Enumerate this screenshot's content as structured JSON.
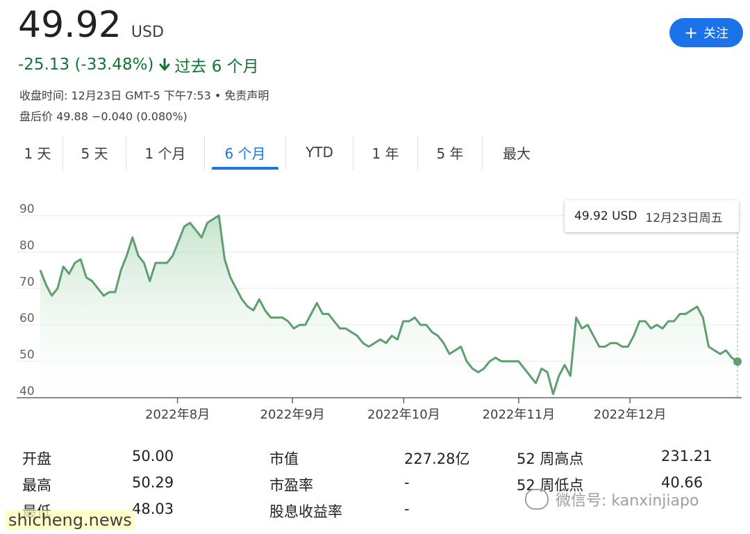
{
  "quote": {
    "price": "49.92",
    "currency": "USD",
    "change": "-25.13 (-33.48%)",
    "period": "过去 6 个月",
    "close_info": "收盘时间: 12月23日 GMT-5 下午7:53 • 免责声明",
    "after_hours": "盘后价 49.88 −0.040 (0.080%)"
  },
  "follow_label": "关注",
  "tabs": [
    "1 天",
    "5 天",
    "1 个月",
    "6 个月",
    "YTD",
    "1 年",
    "5 年",
    "最大"
  ],
  "active_tab": 3,
  "tooltip": {
    "value": "49.92 USD",
    "date": "12月23日周五"
  },
  "colors": {
    "line": "#5f9e6e",
    "fill_top": "#cfe8d3",
    "accent": "#1a73e8",
    "negative": "#137333"
  },
  "chart_data": {
    "type": "area",
    "y_ticks": [
      "90",
      "80",
      "70",
      "60",
      "50",
      "40"
    ],
    "ylim": [
      40,
      90
    ],
    "x_labels": [
      {
        "label": "2022年8月",
        "day": 37
      },
      {
        "label": "2022年9月",
        "day": 68
      },
      {
        "label": "2022年10月",
        "day": 98
      },
      {
        "label": "2022年11月",
        "day": 129
      },
      {
        "label": "2022年12月",
        "day": 159
      }
    ],
    "x_range": [
      0,
      188
    ],
    "values": [
      75,
      71,
      68,
      70,
      76,
      74,
      77,
      78,
      73,
      72,
      70,
      68,
      69,
      69,
      75,
      79,
      84,
      79,
      77,
      72,
      77,
      77,
      77,
      79,
      83,
      87,
      88,
      86,
      84,
      88,
      89,
      90,
      78,
      73,
      70,
      67,
      65,
      64,
      67,
      64,
      62,
      62,
      62,
      61,
      59,
      60,
      60,
      63,
      66,
      63,
      63,
      61,
      59,
      59,
      58,
      57,
      55,
      54,
      55,
      56,
      55,
      57,
      56,
      61,
      61,
      62,
      60,
      60,
      58,
      57,
      55,
      52,
      53,
      54,
      50,
      48,
      47,
      48,
      50,
      51,
      50,
      50,
      50,
      50,
      48,
      46,
      44,
      48,
      47,
      41,
      46,
      49,
      46,
      62,
      59,
      60,
      57,
      54,
      54,
      55,
      55,
      54,
      54,
      57,
      61,
      61,
      59,
      60,
      59,
      61,
      61,
      63,
      63,
      64,
      65,
      62,
      54,
      53,
      52,
      53,
      51,
      49.92
    ]
  },
  "stats": {
    "open_label": "开盘",
    "open": "50.00",
    "high_label": "最高",
    "high": "50.29",
    "low_label": "最低",
    "low": "48.03",
    "mktcap_label": "市值",
    "mktcap": "227.28亿",
    "pe_label": "市盈率",
    "pe": "-",
    "div_label": "股息收益率",
    "div": "-",
    "high52_label": "52 周高点",
    "high52": "231.21",
    "low52_label": "52 周低点",
    "low52": "40.66"
  },
  "watermarks": {
    "wechat": "微信号: kanxinjiapo",
    "site": "shicheng.news"
  }
}
